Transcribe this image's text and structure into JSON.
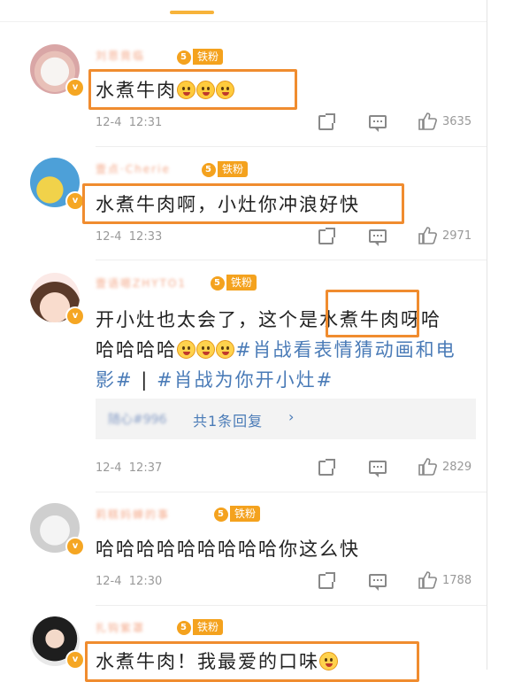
{
  "fan_label": "铁粉",
  "verified_mark": "v",
  "comments": [
    {
      "username": "刘恩竟临",
      "fan_level": "5",
      "text": "水煮牛肉",
      "emojis": [
        "smile-emoji",
        "smile-emoji",
        "smile-emoji"
      ],
      "date": "12-4",
      "time": "12:31",
      "likes": "3635"
    },
    {
      "username": "壹点·Cherie",
      "fan_level": "5",
      "text": "水煮牛肉啊，小灶你冲浪好快",
      "date": "12-4",
      "time": "12:33",
      "likes": "2971"
    },
    {
      "username": "壹语嗯ZHYTO1",
      "fan_level": "5",
      "line1_pre": "开小灶也太会了，这个是",
      "line1_hl": "水煮牛肉",
      "line1_post": "呀哈",
      "line2_pre": "哈哈哈哈",
      "line2_tag": "#肖战看表情猜动画和电",
      "line3_tag1": "影#",
      "line3_sep": "|",
      "line3_tag2": "#肖战为你开小灶#",
      "reply_user": "随心#996",
      "reply_text": "共1条回复",
      "reply_chevron": "›",
      "date": "12-4",
      "time": "12:37",
      "likes": "2829"
    },
    {
      "username": "莉糕妈蝉的事",
      "fan_level": "5",
      "text": "哈哈哈哈哈哈哈哈哈你这么快",
      "date": "12-4",
      "time": "12:30",
      "likes": "1788"
    },
    {
      "username": "扎钩紫罩",
      "fan_level": "5",
      "text": "水煮牛肉！我最爱的口味"
    }
  ],
  "colors": {
    "highlight": "#f08c2f",
    "fan_badge": "#f4a21e",
    "hashtag": "#4a7bb7",
    "meta": "#999999"
  }
}
